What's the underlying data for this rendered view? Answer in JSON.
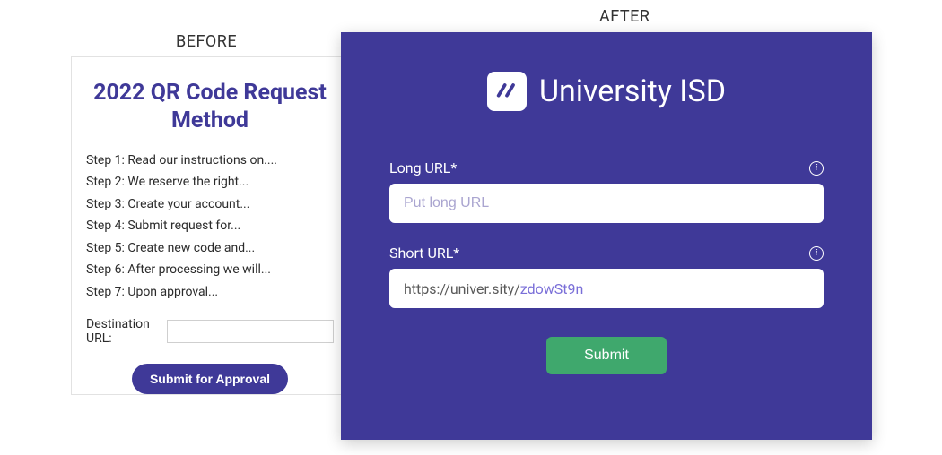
{
  "labels": {
    "before": "BEFORE",
    "after": "AFTER"
  },
  "before": {
    "title": "2022 QR Code Request Method",
    "steps": [
      "Step 1: Read our instructions on....",
      "Step 2: We reserve the right...",
      "Step 3: Create your account...",
      "Step 4: Submit request for...",
      "Step 5: Create new code and...",
      "Step 6: After processing we will...",
      "Step 7: Upon approval..."
    ],
    "destination_label": "Destination URL:",
    "destination_value": "",
    "submit_label": "Submit for Approval"
  },
  "after": {
    "brand": "University ISD",
    "long_url": {
      "label": "Long URL*",
      "placeholder": "Put long URL",
      "value": ""
    },
    "short_url": {
      "label": "Short URL*",
      "prefix": "https://univer.sity/",
      "suffix": "zdowSt9n"
    },
    "submit_label": "Submit"
  },
  "colors": {
    "primary_purple": "#3f3998",
    "accent_green": "#3fa86d",
    "placeholder_purple": "#aaa5d0",
    "short_suffix_purple": "#7a6fd8"
  }
}
